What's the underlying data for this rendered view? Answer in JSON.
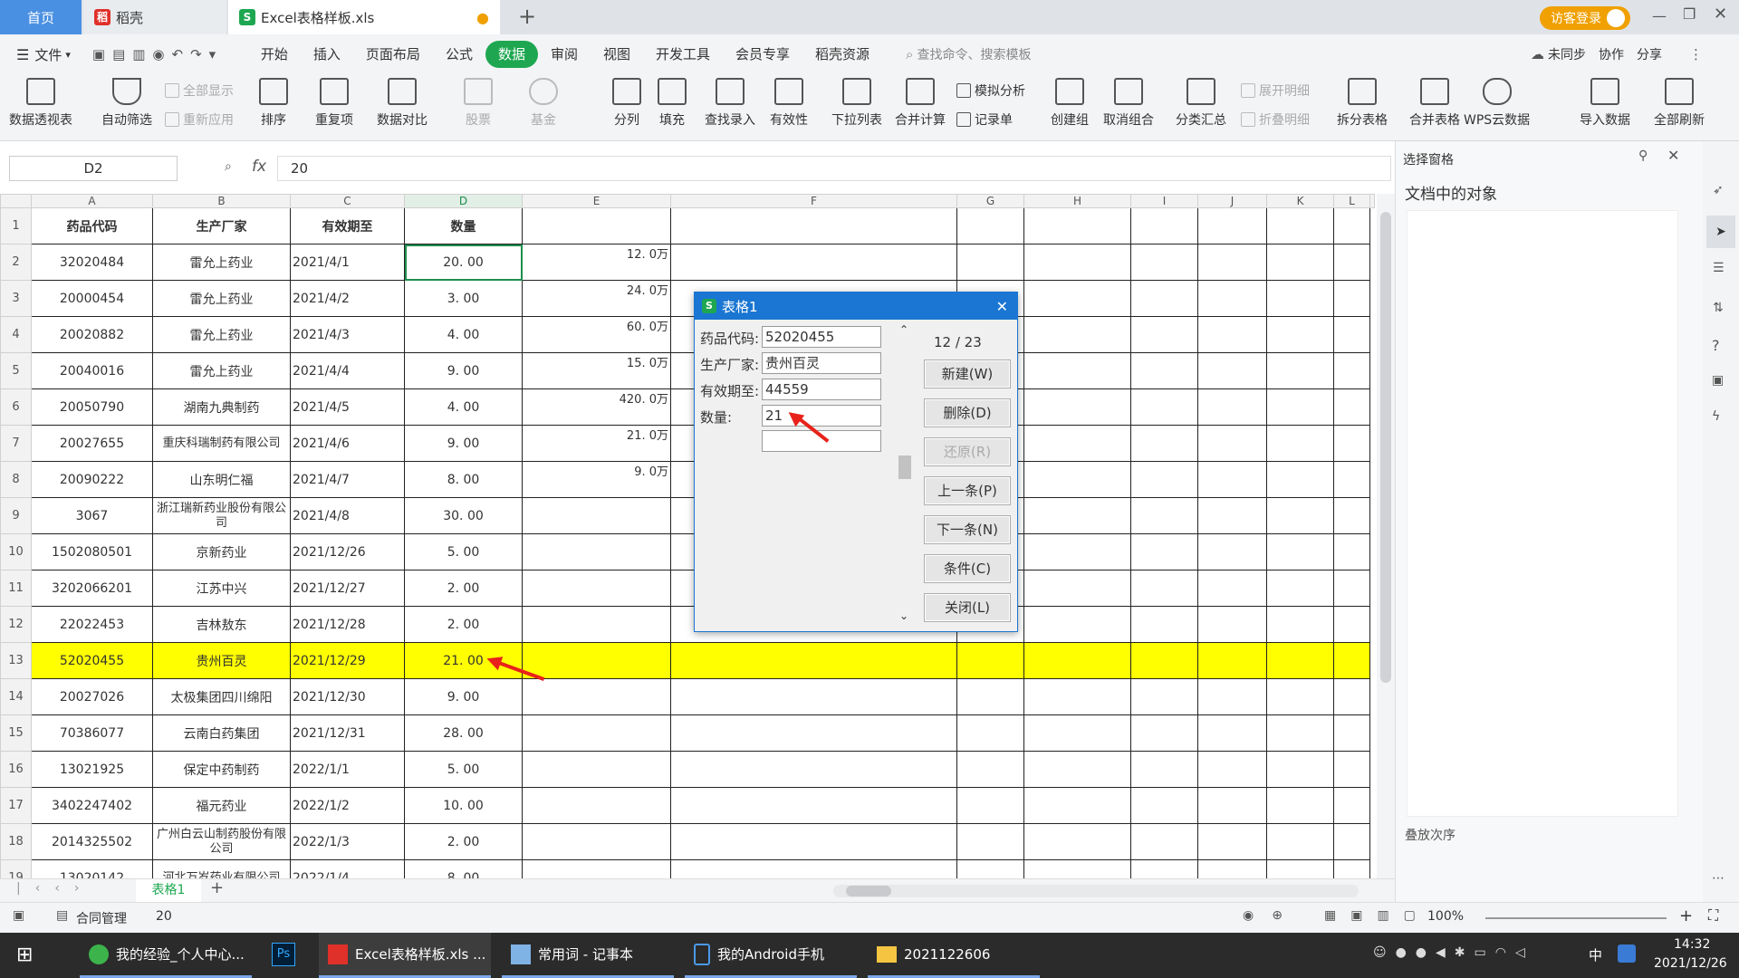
{
  "tabs": {
    "home": "首页",
    "daoke": "稻壳",
    "file": "Excel表格样板.xls",
    "login": "访客登录"
  },
  "menu": {
    "file": "文件",
    "items": [
      "开始",
      "插入",
      "页面布局",
      "公式",
      "数据",
      "审阅",
      "视图",
      "开发工具",
      "会员专享",
      "稻壳资源"
    ],
    "search": "查找命令、搜索模板",
    "sync": "未同步",
    "collab": "协作",
    "share": "分享"
  },
  "ribbon": {
    "pivot": "数据透视表",
    "autofilter": "自动筛选",
    "showall": "全部显示",
    "reapply": "重新应用",
    "sort": "排序",
    "dup": "重复项",
    "compare": "数据对比",
    "stock": "股票",
    "fund": "基金",
    "split": "分列",
    "fill": "填充",
    "lookup": "查找录入",
    "valid": "有效性",
    "dropdown": "下拉列表",
    "consolidate": "合并计算",
    "whatif": "模拟分析",
    "record": "记录单",
    "group": "创建组",
    "ungroup": "取消组合",
    "subtotal": "分类汇总",
    "expand": "展开明细",
    "collapse": "折叠明细",
    "splittable": "拆分表格",
    "mergetable": "合并表格",
    "wpscloud": "WPS云数据",
    "import": "导入数据",
    "refresh": "全部刷新"
  },
  "formula": {
    "cell": "D2",
    "fx": "fx",
    "value": "20"
  },
  "columns": [
    "A",
    "B",
    "C",
    "D",
    "E",
    "F",
    "G",
    "H",
    "I",
    "J",
    "K",
    "L"
  ],
  "header": [
    "药品代码",
    "生产厂家",
    "有效期至",
    "数量"
  ],
  "rows": [
    [
      "2",
      "32020484",
      "雷允上药业",
      "2021/4/1",
      "20. 00",
      "12. 0万"
    ],
    [
      "3",
      "20000454",
      "雷允上药业",
      "2021/4/2",
      "3. 00",
      "24. 0万"
    ],
    [
      "4",
      "20020882",
      "雷允上药业",
      "2021/4/3",
      "4. 00",
      "60. 0万"
    ],
    [
      "5",
      "20040016",
      "雷允上药业",
      "2021/4/4",
      "9. 00",
      "15. 0万"
    ],
    [
      "6",
      "20050790",
      "湖南九典制药",
      "2021/4/5",
      "4. 00",
      "420. 0万"
    ],
    [
      "7",
      "20027655",
      "重庆科瑞制药有限公司",
      "2021/4/6",
      "9. 00",
      "21. 0万"
    ],
    [
      "8",
      "20090222",
      "山东明仁福",
      "2021/4/7",
      "8. 00",
      "9. 0万"
    ],
    [
      "9",
      "3067",
      "浙江瑞新药业股份有限公司",
      "2021/4/8",
      "30. 00",
      ""
    ],
    [
      "10",
      "1502080501",
      "京新药业",
      "2021/12/26",
      "5. 00",
      ""
    ],
    [
      "11",
      "3202066201",
      "江苏中兴",
      "2021/12/27",
      "2. 00",
      ""
    ],
    [
      "12",
      "22022453",
      "吉林敖东",
      "2021/12/28",
      "2. 00",
      ""
    ],
    [
      "13",
      "52020455",
      "贵州百灵",
      "2021/12/29",
      "21. 00",
      ""
    ],
    [
      "14",
      "20027026",
      "太极集团四川绵阳",
      "2021/12/30",
      "9. 00",
      ""
    ],
    [
      "15",
      "70386077",
      "云南白药集团",
      "2021/12/31",
      "28. 00",
      ""
    ],
    [
      "16",
      "13021925",
      "保定中药制药",
      "2022/1/1",
      "5. 00",
      ""
    ],
    [
      "17",
      "3402247402",
      "福元药业",
      "2022/1/2",
      "10. 00",
      ""
    ],
    [
      "18",
      "2014325502",
      "广州白云山制药股份有限公司",
      "2022/1/3",
      "2. 00",
      ""
    ],
    [
      "19",
      "13020142",
      "河北万岁药业有限公司",
      "2022/1/4",
      "8. 00",
      ""
    ]
  ],
  "dialog": {
    "title": "表格1",
    "labels": [
      "药品代码:",
      "生产厂家:",
      "有效期至:",
      "数量:"
    ],
    "values": [
      "52020455",
      "贵州百灵",
      "44559",
      "21"
    ],
    "counter": "12 / 23",
    "buttons": [
      "新建(W)",
      "删除(D)",
      "还原(R)",
      "上一条(P)",
      "下一条(N)",
      "条件(C)",
      "关闭(L)"
    ]
  },
  "pane": {
    "title": "选择窗格",
    "objects": "文档中的对象",
    "order": "叠放次序"
  },
  "sheettab": "表格1",
  "status": {
    "contract": "合同管理",
    "value": "20",
    "zoom": "100%"
  },
  "taskbar": {
    "items": [
      "我的经验_个人中心...",
      "Ps",
      "Excel表格样板.xls ...",
      "常用词 - 记事本",
      "我的Android手机",
      "2021122606"
    ],
    "time": "14:32",
    "date": "2021/12/26",
    "ime": "中"
  },
  "colors": {
    "accent": "#1ea750",
    "highlight": "#ffff00",
    "dialog": "#1a76d2",
    "arrow": "#e8221a"
  }
}
